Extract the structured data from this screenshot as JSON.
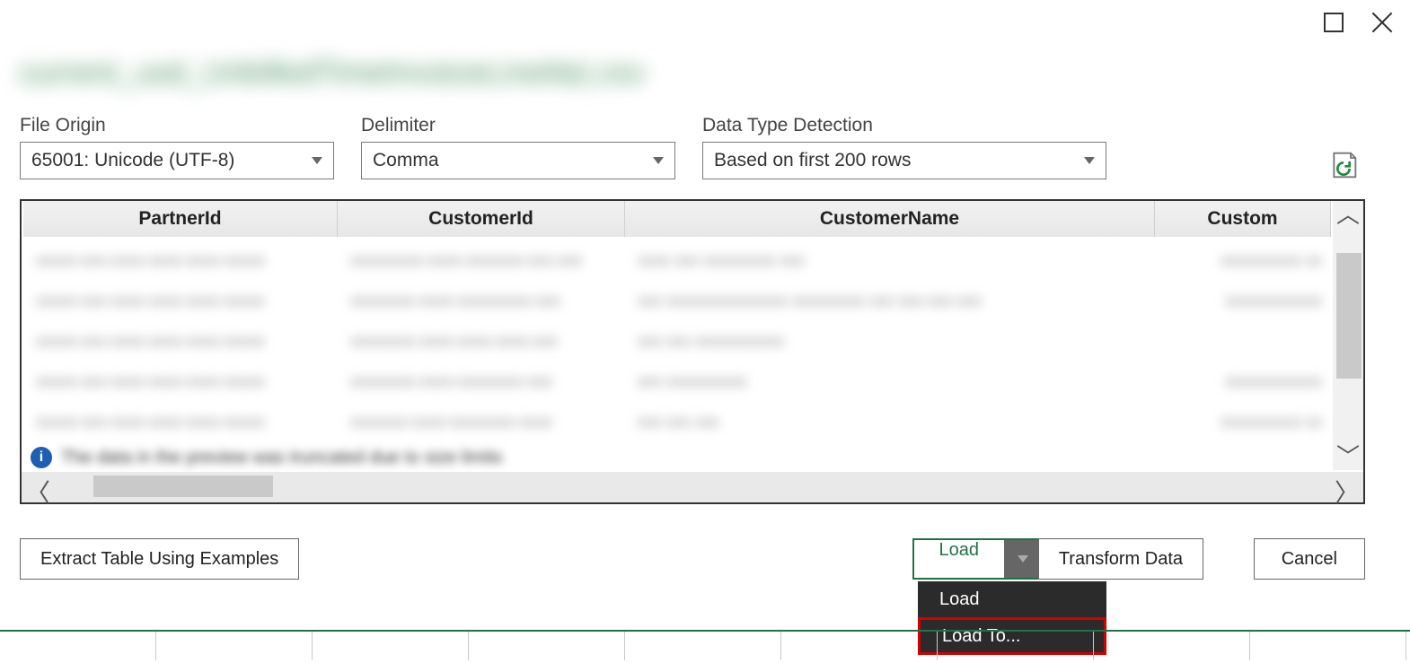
{
  "window": {
    "filename_blurred": "current_usd_UnbilledTimeInvoiceLineIte|.csv"
  },
  "controls": {
    "file_origin": {
      "label": "File Origin",
      "value": "65001: Unicode (UTF-8)"
    },
    "delimiter": {
      "label": "Delimiter",
      "value": "Comma"
    },
    "type_detect": {
      "label": "Data Type Detection",
      "value": "Based on first 200 rows"
    }
  },
  "table": {
    "columns": {
      "c0": "PartnerId",
      "c1": "CustomerId",
      "c2": "CustomerName",
      "c3": "Custom"
    },
    "info_blurred": "The data in the preview was truncated due to size limits",
    "rows": [
      {
        "r0": "xxxxx-xxx-xxxx-xxxx-xxxx-xxxxx",
        "r1": "xxxxxxxxx-xxxx-xxxxxxx-xxx-xxx",
        "r2": "xxxx xxx xxxxxxxxx xxx",
        "r3": "xxxxxxxxxx xx"
      },
      {
        "r0": "xxxxx-xxx-xxxx-xxxx-xxxx-xxxxx",
        "r1": "xxxxxxxx-xxxx-xxxxxxxxx-xxx",
        "r2": "xxx xxxxxxxxxxxxxxx xxxxxxxxx xxx xxx-xxx-xxx",
        "r3": "xxxxxxxxxxxx"
      },
      {
        "r0": "xxxxx-xxx-xxxx-xxxx-xxxx-xxxxx",
        "r1": "xxxxxxxx-xxxx-xxxx-xxxx-xxx",
        "r2": "xxx  xxx  xxxxxxxxxxx",
        "r3": ""
      },
      {
        "r0": "xxxxx-xxx-xxxx-xxxx-xxxx-xxxxx",
        "r1": "xxxxxxxx-xxxx-xxxxxxxx-xxx",
        "r2": "xxx  xxxxxxxxxx",
        "r3": "xxxxxxxxxxxx"
      },
      {
        "r0": "xxxxx-xxx-xxxx-xxxx-xxxx-xxxxx",
        "r1": "xxxxxxx-xxxx-xxxxxxxx-xxxx",
        "r2": "xxx  xxx  xxx",
        "r3": "xxxxxxxxxx xx"
      }
    ]
  },
  "buttons": {
    "extract": "Extract Table Using Examples",
    "load": "Load",
    "transform": "Transform Data",
    "cancel": "Cancel"
  },
  "dropdown": {
    "item0": "Load",
    "item1": "Load To..."
  }
}
